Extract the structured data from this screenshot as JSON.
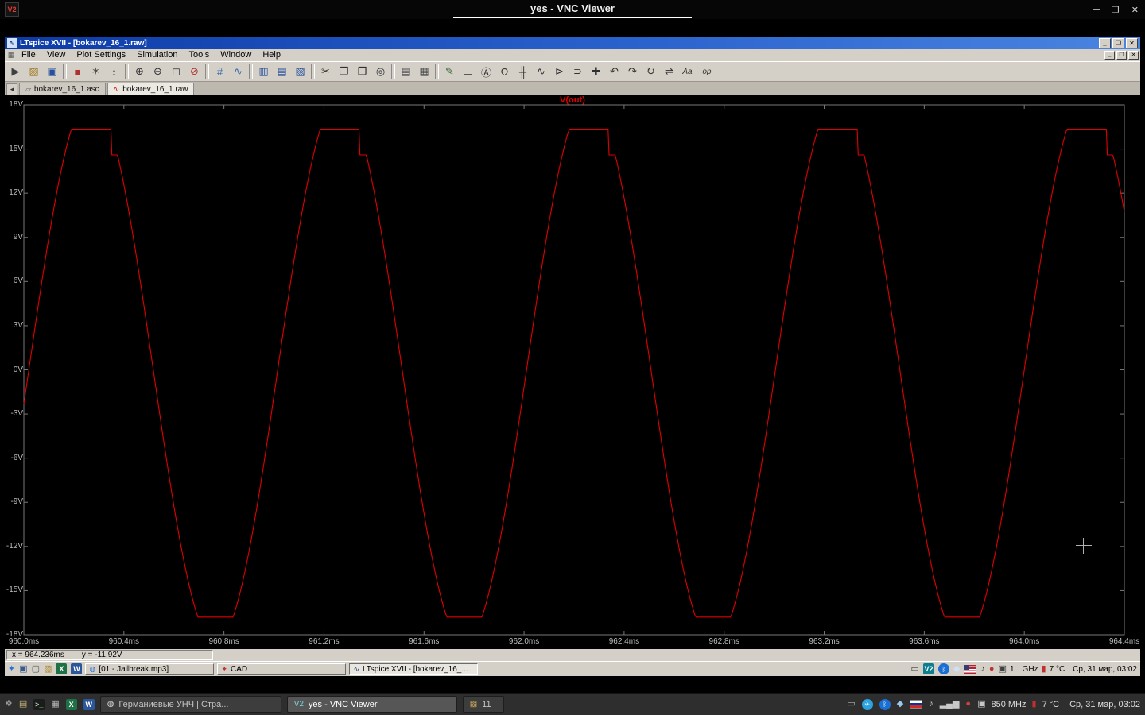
{
  "vnc": {
    "title": "yes - VNC Viewer",
    "logo_text": "V2",
    "controls": [
      {
        "name": "minimize-button",
        "glyph": "─"
      },
      {
        "name": "maximize-button",
        "glyph": "❐"
      },
      {
        "name": "close-button",
        "glyph": "✕"
      }
    ]
  },
  "ltspice": {
    "window_title": "LTspice XVII - [bokarev_16_1.raw]",
    "app_icon_glyph": "∿",
    "mdi_document_glyph": "▦",
    "window_controls": [
      {
        "name": "minimize-button",
        "glyph": "_"
      },
      {
        "name": "restore-button",
        "glyph": "❐"
      },
      {
        "name": "close-button",
        "glyph": "✕"
      }
    ],
    "mdi_controls": [
      {
        "name": "mdi-minimize-button",
        "glyph": "_"
      },
      {
        "name": "mdi-restore-button",
        "glyph": "❐"
      },
      {
        "name": "mdi-close-button",
        "glyph": "✕"
      }
    ],
    "menu_items": [
      "File",
      "View",
      "Plot Settings",
      "Simulation",
      "Tools",
      "Window",
      "Help"
    ],
    "toolbar": [
      {
        "name": "run-icon",
        "glyph": "▶",
        "color": "#404040"
      },
      {
        "name": "open-icon",
        "glyph": "▨",
        "color": "#a07820"
      },
      {
        "name": "save-icon",
        "glyph": "▣",
        "color": "#28509c"
      },
      {
        "sep": true
      },
      {
        "name": "halt-icon",
        "glyph": "■",
        "color": "#b03030"
      },
      {
        "name": "control-panel-icon",
        "glyph": "✶",
        "color": "#505050"
      },
      {
        "name": "autorange-icon",
        "glyph": "↕",
        "color": "#404040"
      },
      {
        "sep": true
      },
      {
        "name": "zoom-in-icon",
        "glyph": "⊕",
        "color": "#303030"
      },
      {
        "name": "zoom-out-icon",
        "glyph": "⊖",
        "color": "#303030"
      },
      {
        "name": "zoom-full-extents-icon",
        "glyph": "◻",
        "color": "#303030"
      },
      {
        "name": "zoom-back-icon",
        "glyph": "⊘",
        "color": "#b03030"
      },
      {
        "sep": true
      },
      {
        "name": "grid-icon",
        "glyph": "#",
        "color": "#3a6ea5"
      },
      {
        "name": "mark-data-points-icon",
        "glyph": "∿",
        "color": "#3a6ea5"
      },
      {
        "sep": true
      },
      {
        "name": "tile-vertical-icon",
        "glyph": "▥",
        "color": "#28509c"
      },
      {
        "name": "tile-horizontal-icon",
        "glyph": "▤",
        "color": "#28509c"
      },
      {
        "name": "cascade-windows-icon",
        "glyph": "▧",
        "color": "#28509c"
      },
      {
        "sep": true
      },
      {
        "name": "cut-icon",
        "glyph": "✂",
        "color": "#303030"
      },
      {
        "name": "copy-icon",
        "glyph": "❐",
        "color": "#303030"
      },
      {
        "name": "paste-icon",
        "glyph": "❒",
        "color": "#303030"
      },
      {
        "name": "find-icon",
        "glyph": "◎",
        "color": "#303030"
      },
      {
        "sep": true
      },
      {
        "name": "print-setup-icon",
        "glyph": "▤",
        "color": "#505050"
      },
      {
        "name": "print-icon",
        "glyph": "▦",
        "color": "#505050"
      },
      {
        "sep": true
      },
      {
        "name": "wire-icon",
        "glyph": "✎",
        "color": "#286028"
      },
      {
        "name": "ground-icon",
        "glyph": "⊥",
        "color": "#303030"
      },
      {
        "name": "label-net-icon",
        "glyph": "Ⓐ",
        "color": "#303030"
      },
      {
        "name": "resistor-icon",
        "glyph": "Ω",
        "color": "#303030"
      },
      {
        "name": "capacitor-icon",
        "glyph": "╫",
        "color": "#303030"
      },
      {
        "name": "inductor-icon",
        "glyph": "∿",
        "color": "#303030"
      },
      {
        "name": "diode-icon",
        "glyph": "⊳",
        "color": "#303030"
      },
      {
        "name": "component-icon",
        "glyph": "⊃",
        "color": "#303030"
      },
      {
        "name": "move-icon",
        "glyph": "✚",
        "color": "#303030"
      },
      {
        "name": "undo-icon",
        "glyph": "↶",
        "color": "#303030"
      },
      {
        "name": "redo-icon",
        "glyph": "↷",
        "color": "#303030"
      },
      {
        "name": "rotate-icon",
        "glyph": "↻",
        "color": "#303030"
      },
      {
        "name": "mirror-icon",
        "glyph": "⇌",
        "color": "#303030"
      },
      {
        "name": "text-icon",
        "glyph": "Aa",
        "color": "#303030",
        "text": true
      },
      {
        "name": "spice-directive-icon",
        "glyph": ".op",
        "color": "#303030",
        "text": true
      }
    ],
    "tab_scroll_glyph": "◂",
    "tabs": [
      {
        "label": "bokarev_16_1.asc",
        "icon_name": "schematic-icon",
        "icon_glyph": "▱",
        "icon_color": "#666666",
        "active": false
      },
      {
        "label": "bokarev_16_1.raw",
        "icon_name": "waveform-icon",
        "icon_glyph": "∿",
        "icon_color": "#cc0000",
        "active": true
      }
    ],
    "status": {
      "x": "x = 964.236ms",
      "y": "y = -11.92V"
    }
  },
  "chart_data": {
    "type": "line",
    "title": "V(out)",
    "background": "#000000",
    "axis_color": "#787878",
    "label_color": "#bebebe",
    "grid": false,
    "legend_position": "top-center",
    "x_axis": {
      "unit": "ms",
      "min": 960.0,
      "max": 964.4,
      "tick_step": 0.4,
      "tick_labels": [
        "960.0ms",
        "960.4ms",
        "960.8ms",
        "961.2ms",
        "961.6ms",
        "962.0ms",
        "962.4ms",
        "962.8ms",
        "963.2ms",
        "963.6ms",
        "964.0ms",
        "964.4ms"
      ]
    },
    "y_axis": {
      "unit": "V",
      "min": -18,
      "max": 18,
      "tick_step": 3,
      "tick_labels": [
        "18V",
        "15V",
        "12V",
        "9V",
        "6V",
        "3V",
        "0V",
        "-3V",
        "-6V",
        "-9V",
        "-12V",
        "-15V",
        "-18V"
      ]
    },
    "series": [
      {
        "name": "V(out)",
        "color": "#e00000",
        "waveform": {
          "shape": "clipped_sine",
          "amplitude_V": 18.6,
          "period_ms": 0.995,
          "rising_zero_ms": 960.02,
          "clip_top_V": 16.3,
          "clip_bottom_V": -16.8,
          "falling_notch_V": 14.6
        }
      }
    ],
    "cursor_readout": {
      "x": "964.236ms",
      "y": "-11.92V"
    }
  },
  "remote_taskbar": {
    "launcher_icons": [
      {
        "name": "start-menu-icon",
        "glyph": "✦",
        "color": "#2a6fd4"
      },
      {
        "name": "my-computer-icon",
        "glyph": "▣",
        "color": "#3a5a8c"
      },
      {
        "name": "show-desktop-icon",
        "glyph": "▢",
        "color": "#555555"
      },
      {
        "name": "file-manager-icon",
        "glyph": "▨",
        "color": "#b08830"
      },
      {
        "name": "excel-icon",
        "glyph": "X",
        "bg": "#1e7145",
        "color": "#ffffff",
        "shape": "box"
      },
      {
        "name": "word-icon",
        "glyph": "W",
        "bg": "#2b579a",
        "color": "#ffffff",
        "shape": "box"
      }
    ],
    "tasks": [
      {
        "icon_name": "media-player-icon",
        "icon_glyph": "◍",
        "icon_color": "#2a6fd4",
        "label": "[01 - Jailbreak.mp3]",
        "active": false
      },
      {
        "icon_name": "cad-icon",
        "icon_glyph": "✦",
        "icon_color": "#c03030",
        "label": "CAD",
        "active": false
      },
      {
        "icon_name": "ltspice-icon",
        "icon_glyph": "∿",
        "icon_color": "#203a70",
        "label": "LTspice XVII - [bokarev_16_...",
        "active": true
      }
    ],
    "tray_icons": [
      {
        "name": "battery-icon",
        "glyph": "▭",
        "color": "#404040"
      },
      {
        "name": "vnc-server-icon",
        "glyph": "V2",
        "bg": "#0b7f8f",
        "color": "#ffffff",
        "shape": "box"
      },
      {
        "name": "bluetooth-icon",
        "glyph": "ᛒ",
        "bg": "#1a6fd4",
        "color": "#ffffff",
        "shape": "circle"
      },
      {
        "name": "drop-icon",
        "glyph": "◆",
        "color": "#cfe0f4"
      },
      {
        "name": "us-flag-icon",
        "shape": "flag-us"
      },
      {
        "name": "volume-icon",
        "glyph": "♪",
        "color": "#303030"
      },
      {
        "name": "status-dot-icon",
        "glyph": "●",
        "color": "#c03030"
      },
      {
        "name": "display-icon",
        "glyph": "▣",
        "color": "#404040"
      }
    ],
    "cpu_value": "1",
    "cpu_unit": "GHz",
    "temp_icon_glyph": "▮",
    "temperature": "7 °C",
    "clock": "Ср, 31 мар, 03:02"
  },
  "host_taskbar": {
    "launcher_icons": [
      {
        "name": "start-menu-icon",
        "glyph": "❖",
        "color": "#9a9a9a"
      },
      {
        "name": "file-manager-icon",
        "glyph": "▤",
        "color": "#c9b27a"
      },
      {
        "name": "terminal-icon",
        "glyph": ">_",
        "bg": "#1b1b1b",
        "color": "#9fdc9f",
        "shape": "box"
      },
      {
        "name": "printer-icon",
        "glyph": "▦",
        "color": "#b8b8b8"
      },
      {
        "name": "calc-icon",
        "glyph": "X",
        "bg": "#1e7145",
        "color": "#ffffff",
        "shape": "box"
      },
      {
        "name": "writer-icon",
        "glyph": "W",
        "bg": "#2b579a",
        "color": "#ffffff",
        "shape": "box"
      }
    ],
    "tasks": [
      {
        "icon_name": "globe-icon",
        "icon_glyph": "◍",
        "icon_color": "#cfd8dc",
        "label": "Германиевые УНЧ | Стра...",
        "active": false
      },
      {
        "icon_name": "vnc-icon",
        "icon_glyph": "V2",
        "icon_color": "#7fd4d4",
        "label": "yes - VNC Viewer",
        "active": true
      },
      {
        "icon_name": "folder-icon",
        "icon_glyph": "▨",
        "icon_color": "#d8b45a",
        "label": "11",
        "active": false
      }
    ],
    "tray_icons": [
      {
        "name": "clipboard-icon",
        "glyph": "▭",
        "color": "#b0b0b0"
      },
      {
        "name": "telegram-icon",
        "glyph": "✈",
        "bg": "#2aa3e0",
        "color": "#ffffff",
        "shape": "circle"
      },
      {
        "name": "bluetooth-icon",
        "glyph": "ᛒ",
        "bg": "#1a6fd4",
        "color": "#ffffff",
        "shape": "circle"
      },
      {
        "name": "drop-icon",
        "glyph": "◆",
        "color": "#9cc7f0"
      },
      {
        "name": "ru-flag-icon",
        "shape": "flag-ru"
      },
      {
        "name": "volume-icon",
        "glyph": "♪",
        "color": "#d0d0d0"
      },
      {
        "name": "signal-bars-icon",
        "glyph": "▂▄▆",
        "color": "#c8c8c8"
      },
      {
        "name": "record-dot-icon",
        "glyph": "●",
        "color": "#d04040"
      },
      {
        "name": "display-icon",
        "glyph": "▣",
        "color": "#c8c8c8"
      }
    ],
    "cpu": "850 MHz",
    "temp_icon_glyph": "▮",
    "temperature": "7 °C",
    "clock": "Ср, 31 мар, 03:02"
  }
}
